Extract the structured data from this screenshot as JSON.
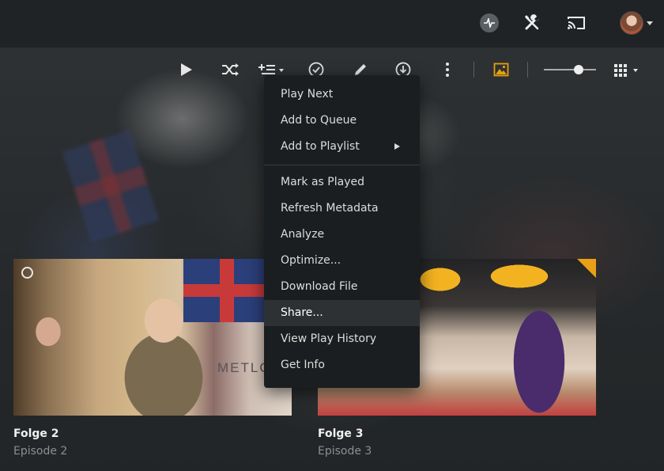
{
  "topbar": {
    "icons": [
      "activity-icon",
      "tools-icon",
      "cast-icon",
      "avatar"
    ]
  },
  "toolbar": {
    "icons": [
      "play-icon",
      "shuffle-icon",
      "add-to-queue-icon",
      "check-circle-icon",
      "pencil-icon",
      "download-icon",
      "more-vertical-icon",
      "image-icon",
      "grid-icon"
    ],
    "accent_color": "#e5a00d",
    "size_slider_value": 0.67
  },
  "menu": {
    "group1": [
      "Play Next",
      "Add to Queue",
      "Add to Playlist"
    ],
    "group2": [
      "Mark as Played",
      "Refresh Metadata",
      "Analyze",
      "Optimize...",
      "Download File",
      "Share...",
      "View Play History",
      "Get Info"
    ],
    "active_item": "Share..."
  },
  "episodes": [
    {
      "title": "Folge 2",
      "subtitle": "Episode 2",
      "thumbnail_sign": "METLO"
    },
    {
      "title": "Folge 3",
      "subtitle": "Episode 3"
    }
  ]
}
